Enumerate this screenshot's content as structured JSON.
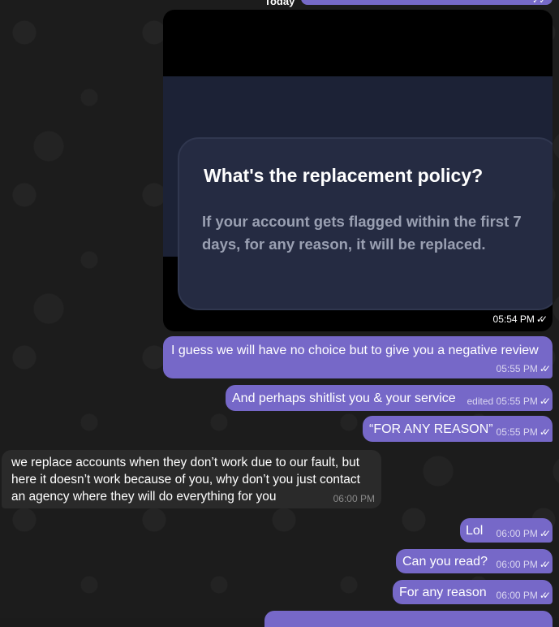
{
  "date_separator": "Today",
  "photo_message": {
    "card_title": "What's the replacement policy?",
    "card_body": "If your account gets flagged within the first 7 days, for any reason, it will be replaced.",
    "time": "05:54 PM"
  },
  "messages": [
    {
      "text": "I guess we will have no choice but to give you a negative review",
      "time": "05:55 PM",
      "direction": "outgoing"
    },
    {
      "text": "And perhaps shitlist you & your service",
      "time": "05:55 PM",
      "edited": "edited",
      "direction": "outgoing"
    },
    {
      "text": "“FOR ANY REASON”",
      "time": "05:55 PM",
      "direction": "outgoing"
    },
    {
      "text": "we replace accounts when they don’t work due to our fault, but here it doesn’t work because of you, why don’t you just contact an agency where they will do everything for you",
      "time": "06:00 PM",
      "direction": "incoming"
    },
    {
      "text": "Lol",
      "time": "06:00 PM",
      "direction": "outgoing"
    },
    {
      "text": "Can you read?",
      "time": "06:00 PM",
      "direction": "outgoing"
    },
    {
      "text": "For any reason",
      "time": "06:00 PM",
      "direction": "outgoing"
    }
  ],
  "read_status_icon": "double-check-icon",
  "colors": {
    "outgoing_bubble": "#7668c8",
    "incoming_bubble": "#2a2a2a",
    "background": "#1c1c1c"
  }
}
